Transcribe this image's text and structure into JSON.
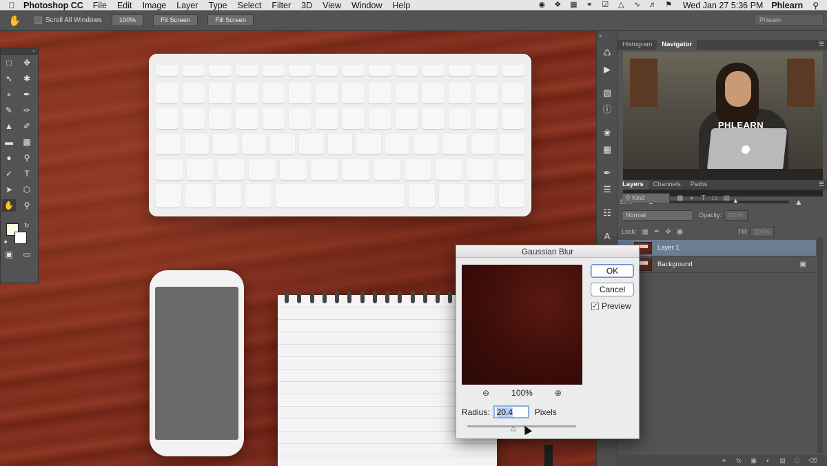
{
  "menubar": {
    "app_name": "Photoshop CC",
    "menus": [
      "File",
      "Edit",
      "Image",
      "Layer",
      "Type",
      "Select",
      "Filter",
      "3D",
      "View",
      "Window",
      "Help"
    ],
    "clock": "Wed Jan 27  5:36 PM",
    "user": "Phlearn"
  },
  "options": {
    "scroll_all_label": "Scroll All Windows",
    "zoom_100": "100%",
    "fit_screen": "Fit Screen",
    "fill_screen": "Fill Screen",
    "workspace": "Phlearn"
  },
  "navigator": {
    "tabs": [
      "Histogram",
      "Navigator"
    ],
    "active_tab": "Navigator",
    "zoom": "50%",
    "shirt_text": "PHLEARN"
  },
  "layers_panel": {
    "tabs": [
      "Layers",
      "Channels",
      "Paths"
    ],
    "active_tab": "Layers",
    "filter_kind": "Kind",
    "blend_mode": "Normal",
    "opacity_label": "Opacity:",
    "opacity_value": "100%",
    "lock_label": "Lock:",
    "fill_label": "Fill:",
    "fill_value": "100%",
    "layers": [
      {
        "name": "Layer 1",
        "selected": true,
        "locked": false
      },
      {
        "name": "Background",
        "selected": false,
        "locked": true
      }
    ]
  },
  "dialog": {
    "title": "Gaussian Blur",
    "ok_label": "OK",
    "cancel_label": "Cancel",
    "preview_label": "Preview",
    "preview_checked": true,
    "zoom_level": "100%",
    "radius_label": "Radius:",
    "radius_value": "20.4",
    "units": "Pixels"
  },
  "colors": {
    "accent_selected_layer": "#6b7d92",
    "foreground_swatch": "#fefde0",
    "background_swatch": "#ffffff",
    "wood": "#7d2c1d"
  }
}
